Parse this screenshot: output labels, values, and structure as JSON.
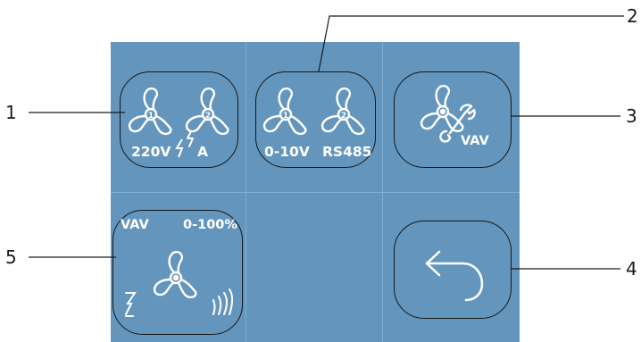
{
  "callouts": [
    "1",
    "2",
    "3",
    "4",
    "5"
  ],
  "tiles": {
    "fan_220v": {
      "label_left": "220V",
      "label_right": "A",
      "fan_numbers": [
        "1",
        "2"
      ]
    },
    "fan_0_10v": {
      "label_left": "0-10V",
      "label_right": "RS485",
      "fan_numbers": [
        "1",
        "2"
      ]
    },
    "vav_settings": {
      "label": "VAV"
    },
    "vav_control": {
      "label_left": "VAV",
      "label_right": "0-100%"
    },
    "back": {
      "icon": "back-arrow-icon"
    }
  },
  "colors": {
    "panel": "#6496bd",
    "grid_line": "#84add0",
    "tile_border": "#151515",
    "icon_white": "#ffffff"
  }
}
